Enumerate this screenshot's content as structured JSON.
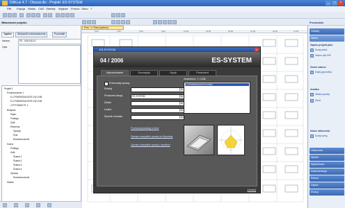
{
  "window": {
    "title": "DIALux 4.7 - Obszar.dlx - Projekt: ES-SYSTEM"
  },
  "menu": [
    "Plik",
    "Edycja",
    "Widok",
    "CAD",
    "Obiekty",
    "Wyjście",
    "Pomoc",
    "Okno",
    "?"
  ],
  "left_panel": {
    "title": "Właściwości projektu",
    "tabs": [
      "Ogólne",
      "Wskaźniki zniekształcenia",
      "Pozostałe"
    ],
    "fields": [
      {
        "label": "Nazwa",
        "value": "ES - KALKULUJ"
      },
      {
        "label": "Opis",
        "value": ""
      }
    ],
    "tree": [
      "Projekt 1",
      "Pomieszczenie 1",
      "E-LTF6/50ES/AGS/T6 CW 1x35",
      "E-LTF6/50ES/AGS/T6 CW 2x35",
      "4.PTF/S6/S0 PL 1",
      "Budynek",
      "Piętro",
      "Podłoga",
      "Sufit",
      "Elementy",
      "Oprawy",
      "Pole",
      "Rozmieszczenie",
      "Scena",
      "Podłoga",
      "Sufit",
      "Ściana 1",
      "Ściana 2",
      "Ściana 3",
      "Ściana 4",
      "Oprawy",
      "Rozmieszczenie",
      "Widoki"
    ]
  },
  "drawing": {
    "tab": "Pom. 1 / Rzut parterny",
    "ruler": [
      "0.00",
      "3.00",
      "6.00",
      "9.00",
      "12.00",
      "15.00",
      "18.00",
      "21.00",
      "24.00",
      "27.00"
    ]
  },
  "dialog": {
    "title": "ES-SYSTEM",
    "number": "04 / 2006",
    "brand": "ES-SYSTEM",
    "tabs": [
      "Wyszukiwanie",
      "Szczegóły",
      "Opcje",
      "Producent"
    ],
    "section": "Przeszukaj oprawy",
    "fields": [
      {
        "label": "Rodzaj",
        "value": ""
      },
      {
        "label": "Producent lampy",
        "value": "ES-SYSTEM"
      },
      {
        "label": "Źródło",
        "value": ""
      },
      {
        "label": "Liczba",
        "value": ""
      },
      {
        "label": "Sposób montażu",
        "value": ""
      }
    ],
    "links": [
      "Przeszukaj katalogi w sieci",
      "Zaznacz wszystkie oprawy do Wyszukaj",
      "Zaznacz wszystkie oprawy z wyników"
    ],
    "results_label": "Znaleziono: 1 / 1432",
    "result_row": "E-LTF6/50ES/AGS/T6   2x35W",
    "close": "Zamknij"
  },
  "right_panel": {
    "title": "Przewodnik",
    "buttons_top": [
      "Obiekty",
      "Widok"
    ],
    "sections": [
      "Zapisz projekt jako",
      "Zmień zakres",
      "Analiza",
      "Nowe obliczenia"
    ],
    "items": [
      "Dodaj widok",
      "Otwórz plik DXF",
      "Edytuj geometrię",
      "Wstaw oprawę",
      "Obrót",
      "Dodaj scenę"
    ],
    "buttons_bottom": [
      "Obliczenia",
      "Wyniki",
      "Wyniki ilustr.",
      "Dokumentacja",
      "Pomoc",
      "Zapisz",
      "Drukuj"
    ]
  },
  "colors": {
    "accent": "#2a62b8",
    "dialog_bg": "#3b3b3b",
    "selection": "#2c55b8"
  }
}
